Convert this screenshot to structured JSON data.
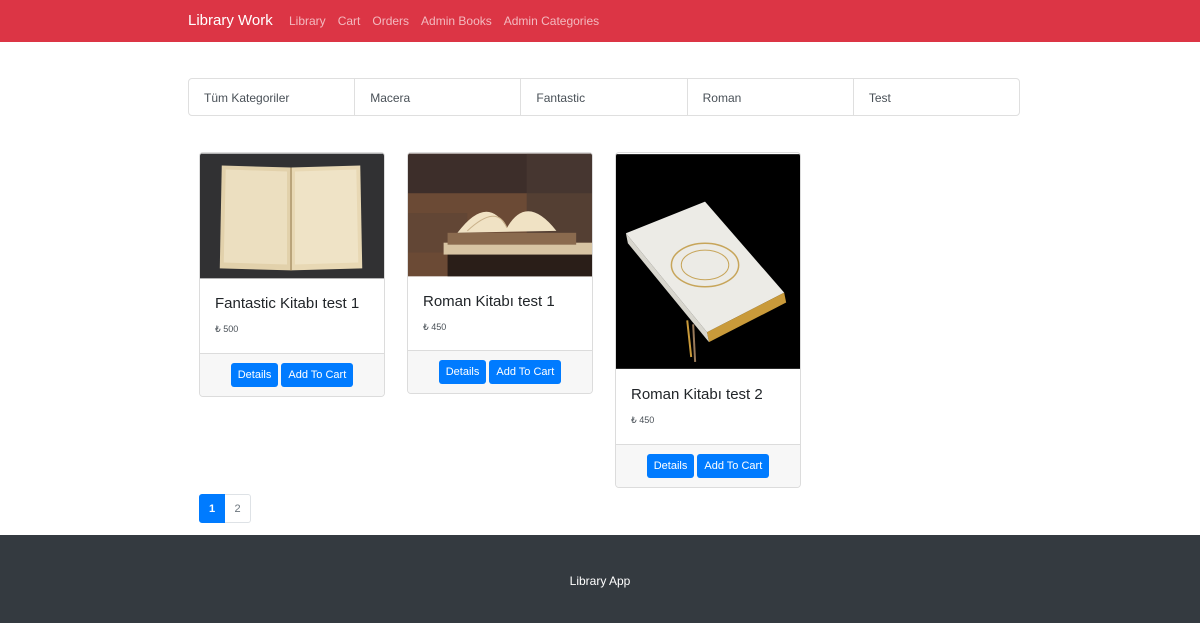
{
  "navbar": {
    "brand": "Library Work",
    "links": [
      "Library",
      "Cart",
      "Orders",
      "Admin Books",
      "Admin Categories"
    ],
    "background": "#dc3545"
  },
  "categories": [
    "Tüm Kategoriler",
    "Macera",
    "Fantastic",
    "Roman",
    "Test"
  ],
  "books": [
    {
      "title": "Fantastic Kitabı test 1",
      "price": "₺ 500",
      "details_label": "Details",
      "cart_label": "Add To Cart"
    },
    {
      "title": "Roman Kitabı test 1",
      "price": "₺ 450",
      "details_label": "Details",
      "cart_label": "Add To Cart"
    },
    {
      "title": "Roman Kitabı test 2",
      "price": "₺ 450",
      "details_label": "Details",
      "cart_label": "Add To Cart"
    }
  ],
  "pagination": {
    "pages": [
      "1",
      "2"
    ],
    "active": "1"
  },
  "footer": {
    "text": "Library App",
    "background": "#343a40"
  },
  "accent_color": "#007bff"
}
